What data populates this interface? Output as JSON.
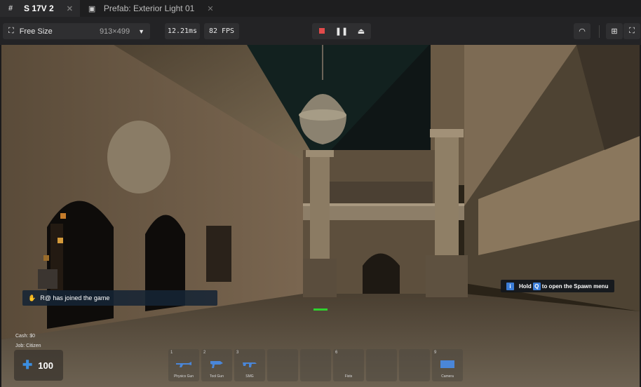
{
  "tabs": [
    {
      "label": "S 17V 2",
      "icon": "grid-hash-icon",
      "active": true
    },
    {
      "label": "Prefab: Exterior Light 01",
      "icon": "robot-icon",
      "active": false
    }
  ],
  "toolbar": {
    "size_label": "Free Size",
    "size_dims": "913×499",
    "frame_ms": "12.21ms",
    "fps": "82 FPS"
  },
  "game": {
    "chat_message": "R@ has joined the game",
    "hint_prefix": "Hold",
    "hint_key": "Q",
    "hint_suffix": "to open the Spawn menu",
    "cash": "Cash: $0",
    "job": "Job: Citizen",
    "health": "100",
    "hotbar": [
      {
        "num": "1",
        "name": "Physics Gun",
        "has_icon": true
      },
      {
        "num": "2",
        "name": "Tool Gun",
        "has_icon": true
      },
      {
        "num": "3",
        "name": "SMG",
        "has_icon": true
      },
      {
        "num": "",
        "name": "",
        "has_icon": false
      },
      {
        "num": "",
        "name": "",
        "has_icon": false
      },
      {
        "num": "6",
        "name": "Fists",
        "has_icon": false
      },
      {
        "num": "",
        "name": "",
        "has_icon": false
      },
      {
        "num": "",
        "name": "",
        "has_icon": false
      },
      {
        "num": "9",
        "name": "Camera",
        "has_icon": true
      }
    ]
  },
  "colors": {
    "accent_blue": "#3b7dd8",
    "stop_red": "#e24b4b"
  }
}
